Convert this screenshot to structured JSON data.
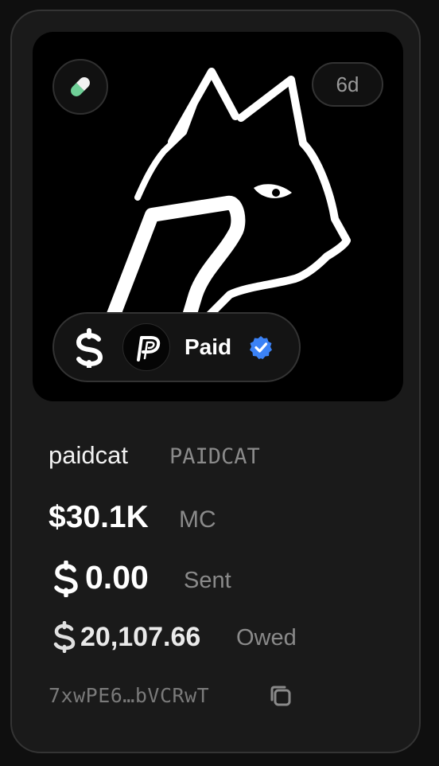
{
  "token": {
    "age": "6d",
    "name": "paidcat",
    "ticker": "PAIDCAT",
    "market_cap": "$30.1K",
    "market_cap_label": "MC",
    "sent": "0.00",
    "sent_label": "Sent",
    "owed": "20,107.66",
    "owed_label": "Owed",
    "address": "7xwPE6…bVCRwT"
  },
  "creator": {
    "name": "Paid",
    "verified": true
  },
  "icons": {
    "pill": "pill-icon",
    "dollar": "dollar-coin-icon",
    "avatar": "paid-logo-avatar",
    "verified": "verified-badge-icon",
    "copy": "copy-icon"
  },
  "colors": {
    "card_background": "#1a1a1a",
    "hero_background": "#000000",
    "verified_blue": "#3b82f6",
    "pill_green": "#6fcf97",
    "text_primary": "#ffffff",
    "text_secondary": "#8a8a8a"
  }
}
